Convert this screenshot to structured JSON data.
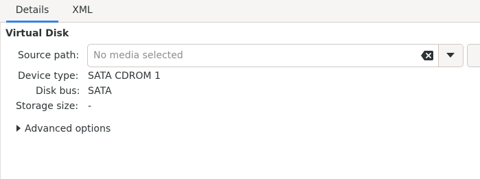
{
  "tabs": [
    {
      "label": "Details",
      "active": true
    },
    {
      "label": "XML",
      "active": false
    }
  ],
  "section_title": "Virtual Disk",
  "source_path": {
    "label": "Source path:",
    "value": "",
    "placeholder": "No media selected"
  },
  "device_type": {
    "label": "Device type:",
    "value": "SATA CDROM 1"
  },
  "disk_bus": {
    "label": "Disk bus:",
    "value": "SATA"
  },
  "storage_size": {
    "label": "Storage size:",
    "value": "-"
  },
  "advanced": {
    "label": "Advanced options",
    "expanded": false
  },
  "colors": {
    "accent": "#3584e4",
    "text": "#2e3436",
    "placeholder": "#8b8e8f"
  },
  "icons": {
    "clear": "edit-clear-icon",
    "dropdown": "chevron-down-icon",
    "expander": "pan-end-icon"
  }
}
